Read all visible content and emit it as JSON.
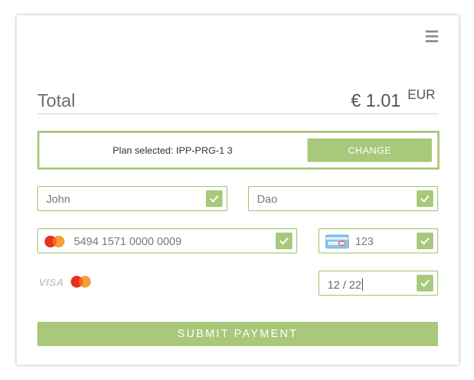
{
  "total": {
    "label": "Total",
    "amount": "€ 1.01",
    "currency": "EUR"
  },
  "plan": {
    "text": "Plan selected: IPP-PRG-1 3",
    "change_label": "CHANGE"
  },
  "form": {
    "first_name": "John",
    "last_name": "Dao",
    "card_number": "5494 1571 0000 0009",
    "cvv": "123",
    "expiry": "12 / 22"
  },
  "brands": {
    "visa": "VISA"
  },
  "submit_label": "SUBMIT PAYMENT",
  "colors": {
    "accent": "#a8c87a",
    "field_border": "#8fbe5e",
    "text": "#777777"
  }
}
